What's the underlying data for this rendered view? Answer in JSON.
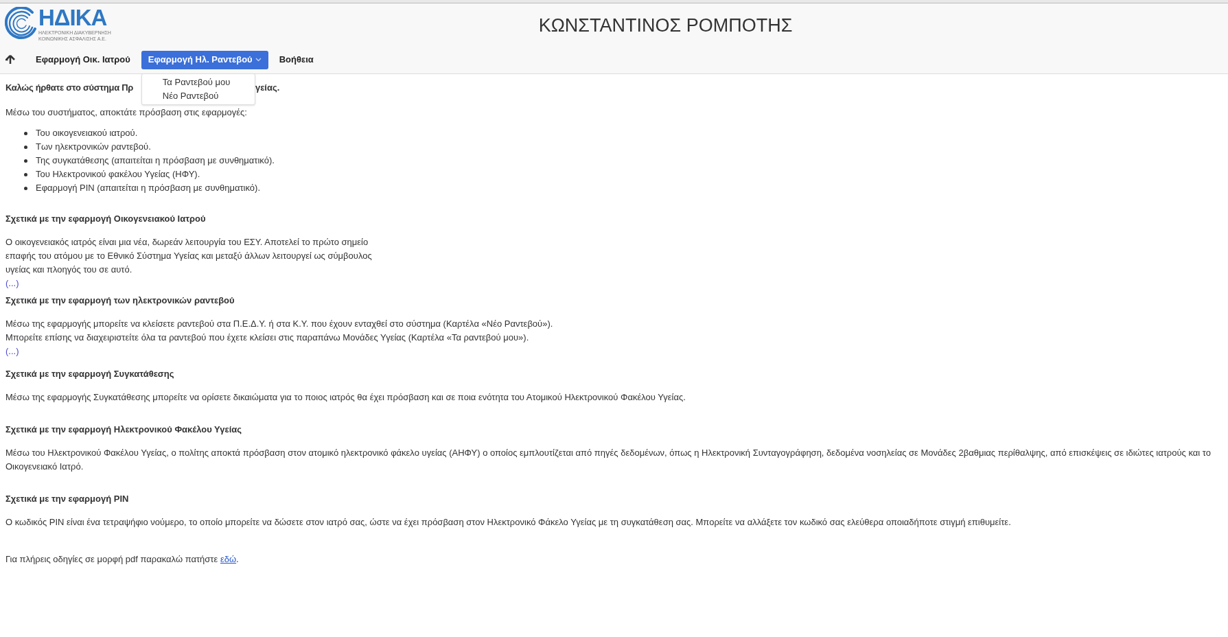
{
  "header": {
    "logo": {
      "name": "ΗΔΙΚΑ",
      "subtitle_lines": [
        "ΗΛΕΚΤΡΟΝΙΚΗ ΔΙΑΚΥΒΕΡΝΗΣΗ",
        "ΚΟΙΝΩΝΙΚΗΣ ΑΣΦΑΛΙΣΗΣ Α.Ε."
      ]
    },
    "user_name": "ΚΩΝΣΤΑΝΤΙΝΟΣ ΡΟΜΠΟΤΗΣ"
  },
  "nav": {
    "items": [
      {
        "kind": "link",
        "label": "Εφαρμογή Οικ. Ιατρού",
        "selected": false
      },
      {
        "kind": "menu",
        "label": "Εφαρμογή Ηλ. Ραντεβού",
        "selected": true
      },
      {
        "kind": "link",
        "label": "Βοήθεια",
        "selected": false
      }
    ]
  },
  "dropdown": {
    "items": [
      "Τα Ραντεβού μου",
      "Νέο Ραντεβού"
    ]
  },
  "content": {
    "welcome_parts": [
      "Καλώς ήρθατε στο σύστημα Πρ",
      "γείας."
    ],
    "intro": "Μέσω του συστήματος, αποκτάτε πρόσβαση στις εφαρμογές:",
    "apps": [
      "Του οικογενειακού ιατρού.",
      "Των ηλεκτρονικών ραντεβού.",
      "Της συγκατάθεσης (απαιτείται η πρόσβαση με συνθηματικό).",
      "Του Ηλεκτρονικού φακέλου Υγείας (ΗΦΥ).",
      "Εφαρμογή PIN (απαιτείται η πρόσβαση με συνθηματικό)."
    ],
    "sections": [
      {
        "heading": "Σχετικά με την εφαρμογή Οικογενειακού Ιατρού",
        "lines": [
          "Ο οικογενειακός ιατρός είναι μια νέα, δωρεάν λειτουργία του ΕΣΥ. Αποτελεί το πρώτο σημείο",
          "επαφής του ατόμου με το Εθνικό Σύστημα Υγείας και μεταξύ άλλων λειτουργεί ως σύμβουλος",
          "υγείας και πλοηγός του σε αυτό."
        ],
        "more_link": "(...)"
      },
      {
        "heading": "Σχετικά με την εφαρμογή των ηλεκτρονικών ραντεβού",
        "lines": [
          "Μέσω της εφαρμογής μπορείτε να κλείσετε ραντεβού στα Π.Ε.Δ.Υ. ή στα Κ.Υ. που έχουν ενταχθεί στο σύστημα (Καρτέλα «Νέο Ραντεβού»).",
          "Μπορείτε επίσης να διαχειριστείτε όλα τα ραντεβού που έχετε κλείσει στις παραπάνω Μονάδες Υγείας (Καρτέλα «Τα ραντεβού μου»)."
        ],
        "more_link": "(...)"
      },
      {
        "heading": "Σχετικά με την εφαρμογή Συγκατάθεσης",
        "lines": [
          "Μέσω της εφαρμογής Συγκατάθεσης μπορείτε να ορίσετε δικαιώματα για το ποιος ιατρός θα έχει πρόσβαση και σε ποια ενότητα του Ατομικού Ηλεκτρονικού Φακέλου Υγείας."
        ]
      },
      {
        "heading": "Σχετικά με την εφαρμογή Ηλεκτρονικού Φακέλου Υγείας",
        "lines": [
          "Μέσω του Ηλεκτρονικού Φακέλου Υγείας, ο πολίτης αποκτά πρόσβαση στον ατομικό ηλεκτρονικό φάκελο υγείας (ΑΗΦΥ) ο οποίος εμπλουτίζεται από πηγές δεδομένων, όπως η Ηλεκτρονική Συνταγογράφηση, δεδομένα νοσηλείας σε Μονάδες 2βαθμιας περίθαλψης, από επισκέψεις σε ιδιώτες ιατρούς και το",
          "Οικογενειακό Ιατρό."
        ]
      },
      {
        "heading": "Σχετικά με την εφαρμογή PIN",
        "lines": [
          "Ο κωδικός PIN είναι ένα τετραψήφιο νούμερο, το οποίο μπορείτε να δώσετε στον ιατρό σας, ώστε να έχει πρόσβαση στον Ηλεκτρονικό Φάκελο Υγείας με τη συγκατάθεση σας. Μπορείτε να αλλάξετε τον κωδικό σας ελεύθερα οποιαδήποτε στιγμή επιθυμείτε."
        ]
      }
    ],
    "footer": {
      "text": "Για πλήρεις οδηγίες σε μορφή pdf παρακαλώ πατήστε ",
      "link": "εδώ",
      "end": "."
    }
  }
}
